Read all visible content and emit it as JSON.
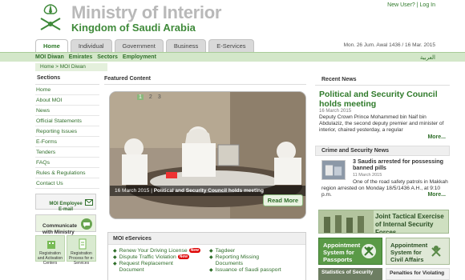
{
  "header": {
    "title": "Ministry of Interior",
    "subtitle": "Kingdom of Saudi Arabia",
    "new_user": "New User?",
    "separator": "|",
    "login": "Log In",
    "date": "Mon. 26 Jum. Awal 1436 / 16 Mar. 2015",
    "emblem_icon": "saudi-emblem-icon"
  },
  "tabs": [
    "Home",
    "Individual",
    "Government",
    "Business",
    "E-Services"
  ],
  "subnav": {
    "links": [
      "MOI Diwan",
      "Emirates",
      "Sectors",
      "Employment"
    ],
    "arabic": "العربية"
  },
  "breadcrumb": {
    "home": "Home",
    "sep": ">",
    "current": "MOI Diwan"
  },
  "sidebar": {
    "title": "Sections",
    "items": [
      "Home",
      "About MOI",
      "News",
      "Official Statements",
      "Reporting Issues",
      "E-Forms",
      "Tenders",
      "FAQs",
      "Rules & Regulations",
      "Contact Us"
    ],
    "email_box": "MOI Employee\nE-mail",
    "communicate": "Communicate\nwith Ministry",
    "tile1": "Registration and Activation Centers",
    "tile2": "Registration Process for e-Services"
  },
  "featured": {
    "title": "Featured Content",
    "slides": [
      "1",
      "2",
      "3"
    ],
    "active_slide": 1,
    "caption_date": "16 March 2015",
    "caption_sep": "|",
    "caption_text": "Political and Security Council holds meeting",
    "read_more": "Read More"
  },
  "services": {
    "title": "MOI eServices",
    "col_a": [
      {
        "label": "Renew Your Driving License",
        "badge": "New"
      },
      {
        "label": "Dispute Traffic Violation",
        "badge": "New"
      },
      {
        "label": "Request Replacement",
        "badge": ""
      },
      {
        "label": "Document",
        "badge": ""
      }
    ],
    "col_b": [
      "Tagdeer",
      "Reporting Missing",
      "Documents",
      "Issuance of Saudi passport"
    ]
  },
  "recent_news": {
    "title": "Recent News",
    "headline": "Political and Security Council holds meeting",
    "date": "16 March 2015",
    "body": "Deputy Crown Prince Mohammed bin Naif bin Abdulaziz, the second deputy premier and minister of interior, chaired yesterday, a regular",
    "more": "More..."
  },
  "crime": {
    "title": "Crime and Security News",
    "headline": "3 Saudis arrested for possessing banned pills",
    "date": "11 March 2015",
    "body": "One of the road safety patrols in Makkah region arrested on Monday 18/5/1436 A.H., at 9:10 p.m.",
    "more": "More..."
  },
  "banner": {
    "text": "Joint Tactical Exercise of Internal Security Forces"
  },
  "promos": [
    "Appointment System for Passports",
    "Appointment System for Civil Affairs"
  ],
  "bottom_tiles": [
    "Statistics of Security",
    "Penalties for Violating"
  ],
  "colors": {
    "brand_green": "#2f7a2a",
    "title_gray": "#b9b9b9",
    "subnav_bg": "#d3e7c9"
  }
}
